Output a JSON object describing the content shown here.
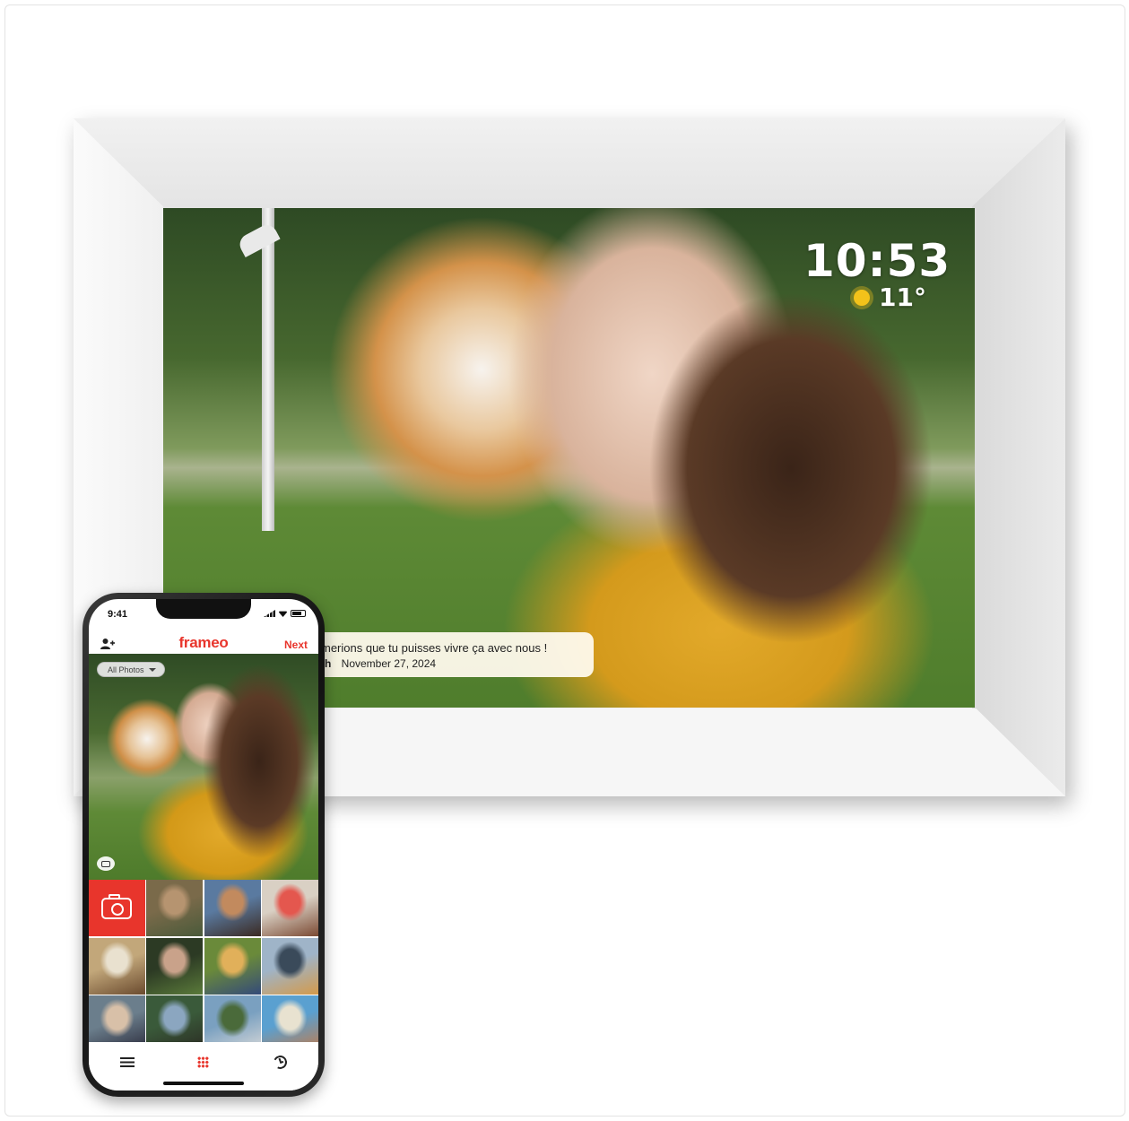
{
  "frame": {
    "clock": "10:53",
    "temperature": "11°",
    "weather_icon": "sun-icon",
    "caption_text": "merions que tu puisses vivre ça avec nous !",
    "caption_author": "th",
    "caption_date": "November 27, 2024"
  },
  "phone": {
    "status_time": "9:41",
    "brand": "frameo",
    "next_label": "Next",
    "album_selector": "All Photos",
    "brand_color": "#e8352c",
    "tabs": [
      {
        "icon": "menu-icon"
      },
      {
        "icon": "grid-icon",
        "active": true
      },
      {
        "icon": "history-icon"
      }
    ],
    "thumbnails": [
      {
        "colors": [
          "#7a6a4a",
          "#b69470",
          "#4a5a3a"
        ]
      },
      {
        "colors": [
          "#5a7aa0",
          "#c28a5e",
          "#3b2a22"
        ]
      },
      {
        "colors": [
          "#d9d0c4",
          "#e4574e",
          "#7b4a33"
        ]
      },
      {
        "colors": [
          "#c2a77a",
          "#e9e1cf",
          "#6a4a2e"
        ]
      },
      {
        "colors": [
          "#2c3a24",
          "#c9a28a",
          "#5a7a3a"
        ]
      },
      {
        "colors": [
          "#6a8a3a",
          "#e1b05a",
          "#344a7a"
        ]
      },
      {
        "colors": [
          "#9fb4c8",
          "#3a4a5a",
          "#d49a4a"
        ]
      },
      {
        "colors": [
          "#6b7e8c",
          "#d8c0a8",
          "#2a2a3a"
        ]
      },
      {
        "colors": [
          "#3a5a3a",
          "#8ba6c0",
          "#2a2a22"
        ]
      },
      {
        "colors": [
          "#7aa0c0",
          "#4a6a3a",
          "#d9d9d9"
        ]
      },
      {
        "colors": [
          "#5aa0d0",
          "#e8e2d0",
          "#c27a4a"
        ]
      }
    ]
  }
}
